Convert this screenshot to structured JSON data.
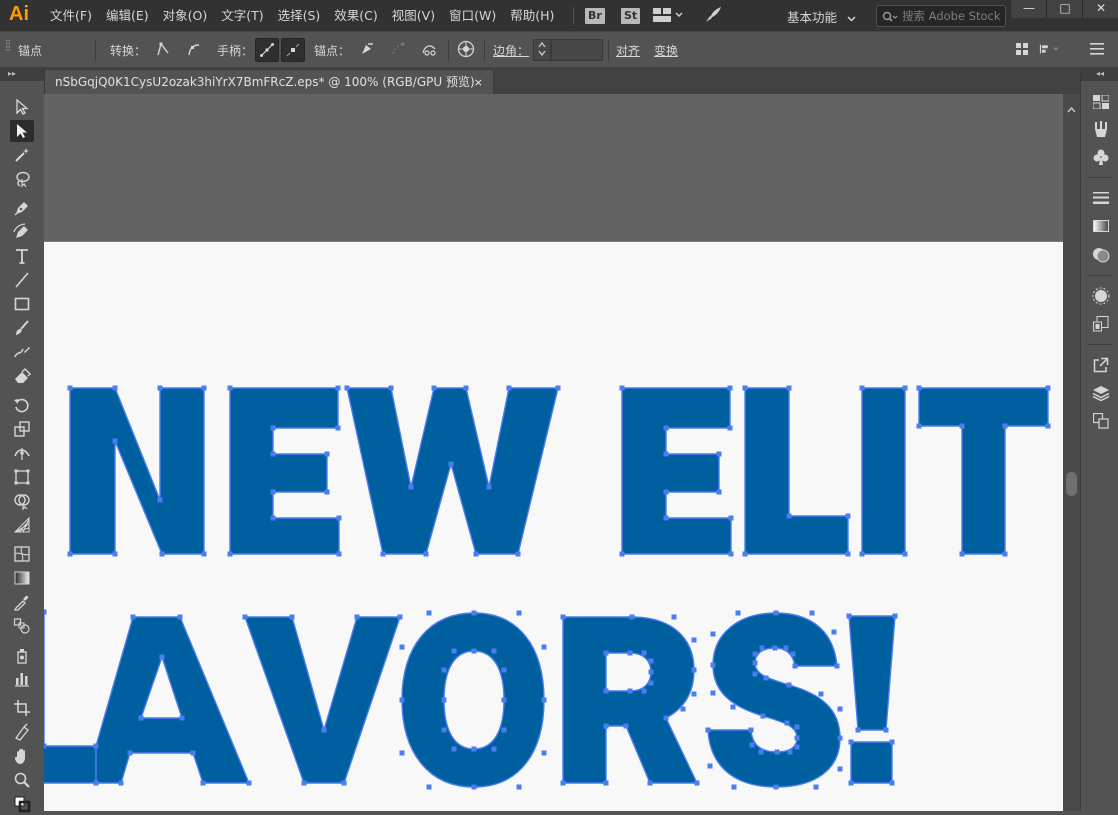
{
  "app": {
    "logo": "Ai"
  },
  "menu": [
    "文件(F)",
    "编辑(E)",
    "对象(O)",
    "文字(T)",
    "选择(S)",
    "效果(C)",
    "视图(V)",
    "窗口(W)",
    "帮助(H)"
  ],
  "apps": {
    "bridge": "Br",
    "stock": "St"
  },
  "workspace": {
    "label": "基本功能"
  },
  "search": {
    "placeholder": "搜索 Adobe Stock"
  },
  "window_controls": {
    "minimize": "—",
    "maximize": "□",
    "close": "✕"
  },
  "controlbar": {
    "anchor_label": "锚点",
    "convert_label": "转换：",
    "handles_label": "手柄：",
    "anchors_label": "锚点：",
    "corner_label": "边角：",
    "corner_value": "",
    "align_label": "对齐",
    "transform_label": "变换"
  },
  "document_tab": {
    "title": "nSbGqjQ0K1CysU2ozak3hiYrX7BmFRcZ.eps* @ 100% (RGB/GPU 预览)",
    "close": "×"
  },
  "artwork": {
    "line1": "NEW ELIT",
    "line2": "LAVORS!",
    "fill_color": "#005f9e",
    "path_color": "#4a7df0"
  },
  "tools": [
    "direct-select",
    "group-select",
    "magic-wand",
    "lasso",
    "pen",
    "curvature",
    "type",
    "line",
    "rectangle",
    "paintbrush",
    "shaper",
    "eraser",
    "rotate",
    "scale",
    "width",
    "free-transform",
    "shape-builder",
    "perspective",
    "mesh",
    "gradient",
    "eyedropper",
    "blend",
    "symbol-sprayer",
    "graph",
    "artboard",
    "slice",
    "hand",
    "zoom"
  ],
  "right_panels": [
    "color",
    "brushes",
    "symbols",
    "stroke",
    "gradient",
    "transparency",
    "appearance",
    "graphic-styles",
    "export",
    "layers",
    "artboards"
  ]
}
